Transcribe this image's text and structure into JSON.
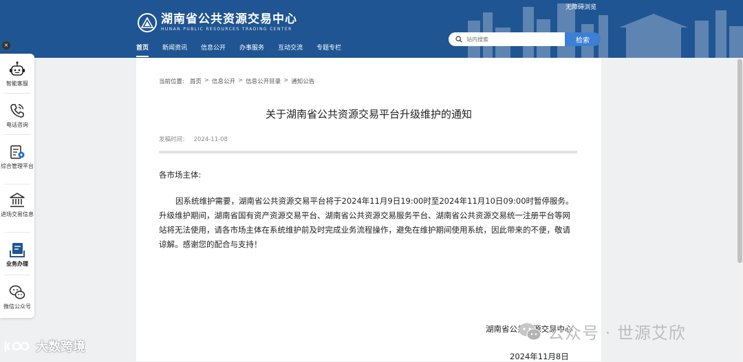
{
  "header": {
    "logo_cn": "湖南省公共资源交易中心",
    "logo_en": "HUNAN PUBLIC RESOURCES TRADING CENTER",
    "barrier_free": "无障碍浏览",
    "search_placeholder": "站内搜索",
    "search_button": "检索",
    "nav": [
      "首页",
      "新闻资讯",
      "信息公开",
      "办事服务",
      "互动交流",
      "专题专栏"
    ]
  },
  "sidebar": {
    "close_icon": "×",
    "items": [
      {
        "label": "智能客服",
        "icon": "robot-icon"
      },
      {
        "label": "电话咨询",
        "icon": "phone-icon"
      },
      {
        "label": "综合管理平台",
        "icon": "management-platform-icon"
      },
      {
        "label": "进场交易信息",
        "icon": "bank-building-icon"
      },
      {
        "label": "业务办理",
        "icon": "business-handling-icon"
      },
      {
        "label": "微信公众号",
        "icon": "wechat-icon"
      }
    ]
  },
  "breadcrumb": {
    "prefix": "当前位置:",
    "items": [
      "首页",
      "信息公开",
      "信息公开目录",
      "通知公告"
    ],
    "separator": ">"
  },
  "article": {
    "title": "关于湖南省公共资源交易平台升级维护的通知",
    "pub_label": "发稿时间：",
    "pub_date": "2024-11-08",
    "greeting": "各市场主体:",
    "body": "因系统维护需要，湖南省公共资源交易平台将于2024年11月9日19:00时至2024年11月10日09:00时暂停服务。升级维护期间，湖南省国有资产资源交易平台、湖南省公共资源交易服务平台、湖南省公共资源交易统一注册平台等网站将无法使用，请各市场主体在系统维护前及时完成业务流程操作，避免在维护期间使用系统，因此带来的不便，敬请谅解。感谢您的配合与支持！",
    "signature": "湖南省公共资源交易中心",
    "sign_date": "2024年11月8日"
  },
  "watermarks": {
    "left": "大数跨境",
    "right": "公众号 · 世源艾欣"
  },
  "colors": {
    "header_bg": "#1f5593",
    "search_button": "#3d7fd2",
    "business_icon": "#1f5593"
  }
}
